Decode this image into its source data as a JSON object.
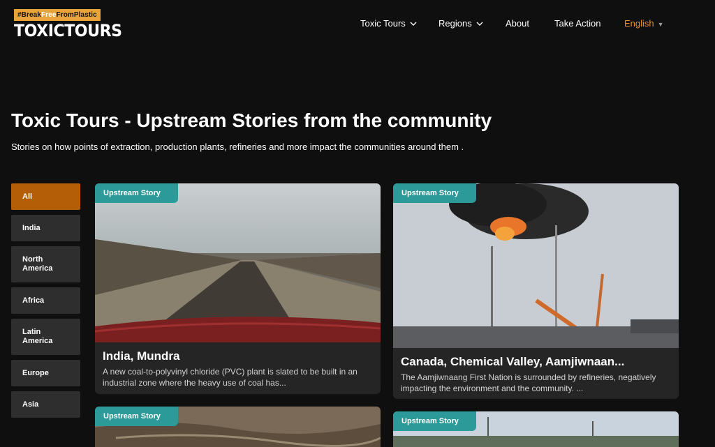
{
  "header": {
    "logo_tag_pre": "#Break",
    "logo_tag_free": "Free",
    "logo_tag_post": "FromPlastic",
    "logo_main": "TOXICTOURS",
    "nav": [
      {
        "label": "Toxic Tours",
        "has_dropdown": true
      },
      {
        "label": "Regions",
        "has_dropdown": true
      },
      {
        "label": "About",
        "has_dropdown": false
      },
      {
        "label": "Take Action",
        "has_dropdown": false
      }
    ],
    "language": "English"
  },
  "page": {
    "title": "Toxic Tours - Upstream Stories from the community",
    "subtitle": "Stories on how points of extraction, production plants, refineries and more impact the communities around them ."
  },
  "filters": [
    {
      "label": "All",
      "active": true
    },
    {
      "label": "India",
      "active": false
    },
    {
      "label": "North America",
      "active": false
    },
    {
      "label": "Africa",
      "active": false
    },
    {
      "label": "Latin America",
      "active": false
    },
    {
      "label": "Europe",
      "active": false
    },
    {
      "label": "Asia",
      "active": false
    }
  ],
  "cards": [
    {
      "badge": "Upstream Story",
      "title": "India, Mundra",
      "description": "A new coal-to-polyvinyl chloride (PVC) plant is slated to be built in an industrial zone where the heavy use of coal has..."
    },
    {
      "badge": "Upstream Story",
      "title": "Canada, Chemical Valley, Aamjiwnaan...",
      "description": "The Aamjiwnaang First Nation is surrounded by refineries, negatively impacting the environment and the community. ..."
    },
    {
      "badge": "Upstream Story"
    },
    {
      "badge": "Upstream Story"
    }
  ],
  "colors": {
    "background": "#0f0f0f",
    "accent_orange": "#b45f07",
    "badge_teal": "#2b9a98",
    "language_orange": "#e8902c",
    "card_bg": "#252525",
    "filter_bg": "#2e2e2e"
  },
  "icons": {
    "dropdown": "chevron-down-icon",
    "language_caret": "caret-down-icon"
  }
}
